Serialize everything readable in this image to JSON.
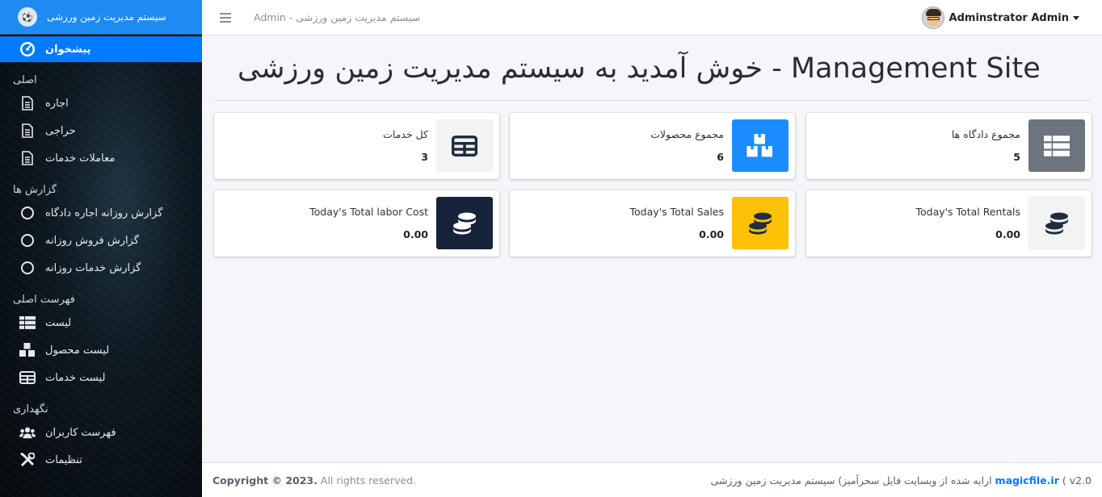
{
  "brand": {
    "title": "سیستم مدیریت زمین ورزشی"
  },
  "sidebar": {
    "active": {
      "label": "پیشخوان",
      "icon": "dashboard-gauge-icon"
    },
    "sections": [
      {
        "header": "اصلی",
        "items": [
          {
            "label": "اجاره",
            "icon": "file-icon"
          },
          {
            "label": "حراجی",
            "icon": "file-icon"
          },
          {
            "label": "معاملات خدمات",
            "icon": "file-icon"
          }
        ]
      },
      {
        "header": "گزارش ها",
        "items": [
          {
            "label": "گزارش روزانه اجاره دادگاه",
            "icon": "circle-icon"
          },
          {
            "label": "گزارش فروش روزانه",
            "icon": "circle-icon"
          },
          {
            "label": "گزارش خدمات روزانه",
            "icon": "circle-icon"
          }
        ]
      },
      {
        "header": "فهرست اصلی",
        "items": [
          {
            "label": "لیست",
            "icon": "list-table-icon"
          },
          {
            "label": "لیست محصول",
            "icon": "boxes-icon"
          },
          {
            "label": "لیست خدمات",
            "icon": "grid-table-icon"
          }
        ]
      },
      {
        "header": "نگهداری",
        "items": [
          {
            "label": "فهرست کاربران",
            "icon": "users-icon"
          },
          {
            "label": "تنظیمات",
            "icon": "tools-icon"
          }
        ]
      }
    ]
  },
  "navbar": {
    "title": "Admin - سیستم مدیریت زمین ورزشی",
    "user": "Adminstrator Admin"
  },
  "main": {
    "title": "خوش آمدید به سیستم مدیریت زمین ورزشی - Management Site",
    "cards": [
      {
        "label": "مجموع دادگاه ها",
        "value": "5",
        "icon": "list-table-icon",
        "color": "#6c757d"
      },
      {
        "label": "مجموع محصولات",
        "value": "6",
        "icon": "boxes-icon",
        "color": "#007bff"
      },
      {
        "label": "کل خدمات",
        "value": "3",
        "icon": "grid-table-icon",
        "color": "#f8f9fa"
      },
      {
        "label": "Today's Total Rentals",
        "value": "0.00",
        "icon": "coins-icon",
        "color": "#f8f9fa"
      },
      {
        "label": "Today's Total Sales",
        "value": "0.00",
        "icon": "coins-icon",
        "color": "#ffc107"
      },
      {
        "label": "Today's Total labor Cost",
        "value": "0.00",
        "icon": "coins-icon",
        "color": "#17223b"
      }
    ]
  },
  "footer": {
    "copyright_bold": "Copyright © 2023.",
    "copyright_rest": " All rights reserved.",
    "version": "v2.0",
    "credit_text": "ارایه شده از وبسایت فایل سحرآمیز) سیستم مدیریت زمین ورزشی",
    "credit_link": "magicfile.ir"
  }
}
